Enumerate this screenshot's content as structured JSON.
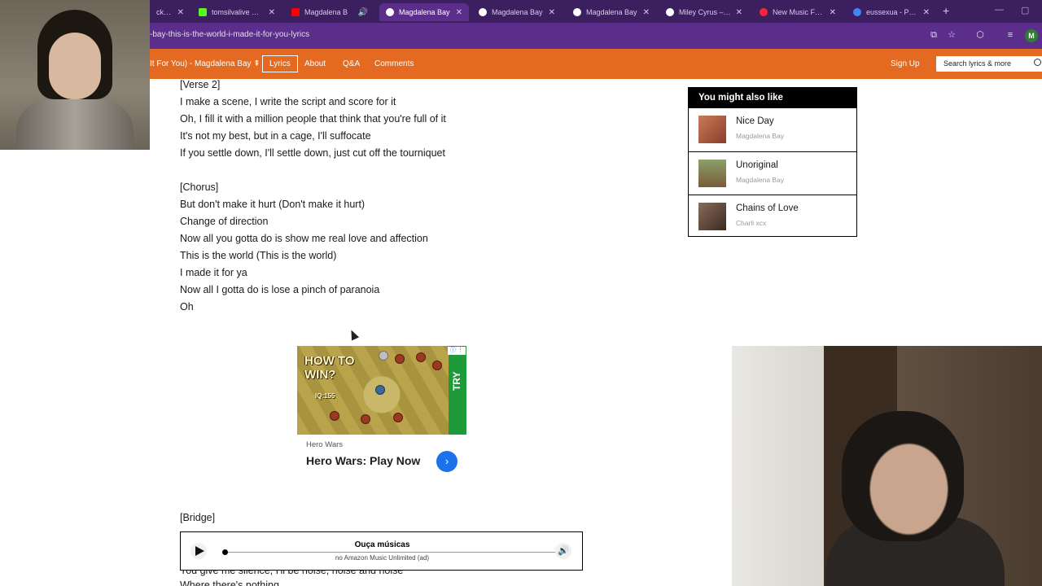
{
  "browser": {
    "tabs": [
      {
        "label": "ck Da",
        "favicon_color": "#d93025"
      },
      {
        "label": "tomsilvalive Strea",
        "favicon_color": "#53fc18"
      },
      {
        "label": "Magdalena B",
        "favicon_color": "#ff0000"
      },
      {
        "label": "Magdalena Bay",
        "favicon_color": "#ffffff"
      },
      {
        "label": "Magdalena Bay",
        "favicon_color": "#ffffff"
      },
      {
        "label": "Magdalena Bay",
        "favicon_color": "#ffffff"
      },
      {
        "label": "Miley Cyrus – Dre",
        "favicon_color": "#ffffff"
      },
      {
        "label": "New Music Friday",
        "favicon_color": "#fa233b"
      },
      {
        "label": "eussexua - Pesqu",
        "favicon_color": "#4285f4"
      }
    ],
    "active_tab_index": 3,
    "url": "-bay-this-is-the-world-i-made-it-for-you-lyrics",
    "profile_initial": "M"
  },
  "site_nav": {
    "song_crumb": "It For You) - Magdalena Bay ⇞",
    "links": {
      "lyrics": "Lyrics",
      "about": "About",
      "qa": "Q&A",
      "comments": "Comments"
    },
    "signup": "Sign Up",
    "search_placeholder": "Search lyrics & more"
  },
  "lyrics": {
    "lines": [
      "[Verse 2]",
      "I make a scene, I write the script and score for it",
      "Oh, I fill it with a million people that think that you're full of it",
      "It's not my best, but in a cage, I'll suffocate",
      "If you settle down, I'll settle down, just cut off the tourniquet",
      "",
      "[Chorus]",
      "But don't make it hurt (Don't make it hurt)",
      "Change of direction",
      "Now all you gotta do is show me real love and affection",
      "This is the world (This is the world)",
      "I made it for ya",
      "Now all I gotta do is lose a pinch of paranoia",
      "Oh"
    ],
    "bridge_label": "[Bridge]",
    "below_player_1": "You give me silence, I'll be noise, noise and noise",
    "below_player_2": "Where there's nothing"
  },
  "ad": {
    "creative_title": "HOW TO WIN?",
    "iq_text": "IQ:155",
    "try_label": "TRY",
    "advertiser": "Hero Wars",
    "headline": "Hero Wars: Play Now",
    "cta_icon": "chevron-right-icon"
  },
  "player": {
    "title": "Ouça músicas",
    "subtitle": "no Amazon Music Unlimited (ad)",
    "progress_fraction": 0.0
  },
  "sidebar": {
    "title": "You might also like",
    "items": [
      {
        "title": "Nice Day",
        "artist": "Magdalena Bay",
        "thumb_color": "#b8674a"
      },
      {
        "title": "Unoriginal",
        "artist": "Magdalena Bay",
        "thumb_color": "#7a8a5a"
      },
      {
        "title": "Chains of Love",
        "artist": "Charli xcx",
        "thumb_color": "#6a4a3a"
      }
    ]
  }
}
